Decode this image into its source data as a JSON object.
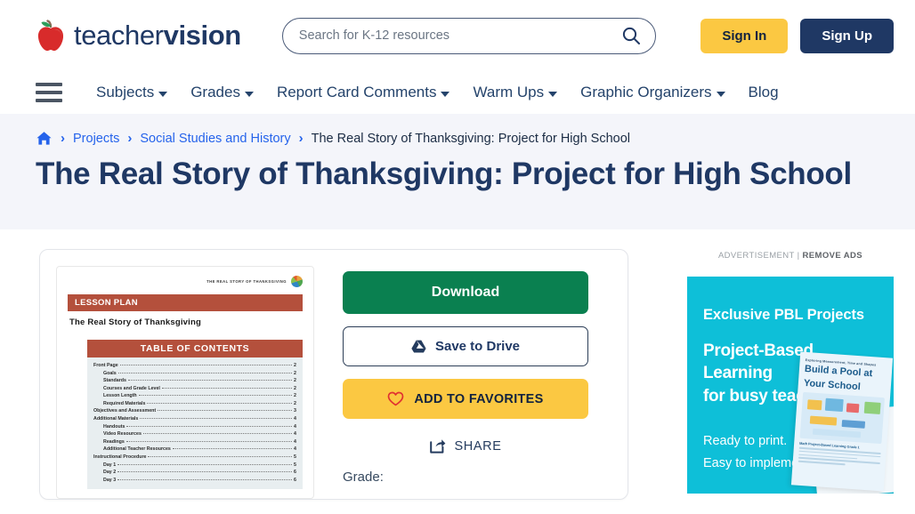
{
  "header": {
    "logo_text_light": "teacher",
    "logo_text_bold": "vision",
    "logo_icon": "apple-icon",
    "search": {
      "placeholder": "Search for K-12 resources",
      "value": "",
      "icon": "search-icon"
    },
    "sign_in_label": "Sign In",
    "sign_up_label": "Sign Up",
    "accent_yellow": "#fbc842",
    "accent_navy": "#1f3864"
  },
  "nav": {
    "menu_icon": "hamburger-icon",
    "items": [
      {
        "label": "Subjects",
        "has_caret": true
      },
      {
        "label": "Grades",
        "has_caret": true
      },
      {
        "label": "Report Card Comments",
        "has_caret": true
      },
      {
        "label": "Warm Ups",
        "has_caret": true
      },
      {
        "label": "Graphic Organizers",
        "has_caret": true
      },
      {
        "label": "Blog",
        "has_caret": false
      }
    ]
  },
  "breadcrumb": {
    "home_icon": "home-icon",
    "separator": "›",
    "items": [
      {
        "label": "Projects",
        "current": false
      },
      {
        "label": "Social Studies and History",
        "current": false
      },
      {
        "label": "The Real Story of Thanksgiving: Project for High School",
        "current": true
      }
    ]
  },
  "page_title": "The Real Story of Thanksgiving: Project for High School",
  "thumbnail": {
    "header_text": "THE REAL STORY OF THANKSGIVING",
    "logo_icon": "globe-logo-icon",
    "banner_label": "LESSON PLAN",
    "subtitle": "The Real Story of Thanksgiving",
    "toc_title": "TABLE OF CONTENTS",
    "toc_entries": [
      {
        "label": "Front Page",
        "page": "2",
        "sub": false
      },
      {
        "label": "Goals",
        "page": "2",
        "sub": true
      },
      {
        "label": "Standards",
        "page": "2",
        "sub": true
      },
      {
        "label": "Courses and Grade Level",
        "page": "2",
        "sub": true
      },
      {
        "label": "Lesson Length",
        "page": "2",
        "sub": true
      },
      {
        "label": "Required Materials",
        "page": "2",
        "sub": true
      },
      {
        "label": "Objectives and Assessment",
        "page": "3",
        "sub": false
      },
      {
        "label": "Additional Materials",
        "page": "4",
        "sub": false
      },
      {
        "label": "Handouts",
        "page": "4",
        "sub": true
      },
      {
        "label": "Video Resources",
        "page": "4",
        "sub": true
      },
      {
        "label": "Readings",
        "page": "4",
        "sub": true
      },
      {
        "label": "Additional Teacher Resources",
        "page": "4",
        "sub": true
      },
      {
        "label": "Instructional Procedure",
        "page": "5",
        "sub": false
      },
      {
        "label": "Day 1",
        "page": "5",
        "sub": true
      },
      {
        "label": "Day 2",
        "page": "6",
        "sub": true
      },
      {
        "label": "Day 3",
        "page": "6",
        "sub": true
      }
    ]
  },
  "actions": {
    "download_label": "Download",
    "download_color": "#0a8050",
    "drive_label": "Save to Drive",
    "drive_icon": "google-drive-icon",
    "favorites_label": "ADD TO FAVORITES",
    "favorites_icon": "heart-icon",
    "favorites_color": "#fbc842",
    "share_label": "SHARE",
    "share_icon": "share-icon",
    "grade_label": "Grade:"
  },
  "ad": {
    "advertisement_label": "ADVERTISEMENT",
    "divider": "|",
    "remove_ads_label": "REMOVE ADS",
    "banner_bg": "#0ebfd8",
    "heading": "Exclusive PBL Projects",
    "subheading_line1": "Project-Based",
    "subheading_line2": "Learning",
    "subheading_line3": "for busy teachers",
    "footer_line1": "Ready to print.",
    "footer_line2": "Easy to implement.",
    "book": {
      "kicker": "Exploring Measurement, Time and Shapes",
      "title_line1": "Build a Pool at",
      "title_line2": "Your School",
      "subtitle": "Math Project-Based Learning Grade 1"
    }
  }
}
